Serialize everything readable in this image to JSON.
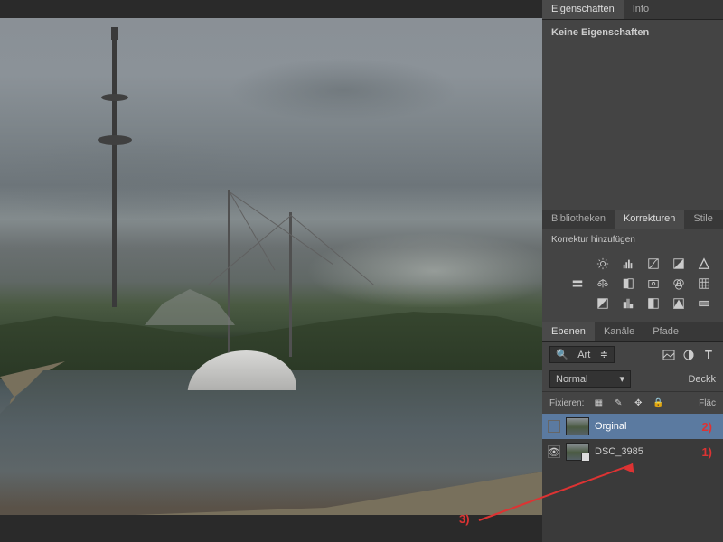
{
  "properties_panel": {
    "tabs": {
      "properties": "Eigenschaften",
      "info": "Info"
    },
    "empty_text": "Keine Eigenschaften"
  },
  "adjustments_panel": {
    "tabs": {
      "libraries": "Bibliotheken",
      "adjustments": "Korrekturen",
      "styles": "Stile"
    },
    "label": "Korrektur hinzufügen",
    "icons": [
      "brightness-icon",
      "levels-icon",
      "curves-icon",
      "exposure-icon",
      "vibrance-icon",
      "hue-icon",
      "balance-icon",
      "bw-icon",
      "photo-filter-icon",
      "channel-mixer-icon",
      "color-lookup-icon",
      "invert-icon",
      "posterize-icon",
      "threshold-icon",
      "selective-color-icon",
      "gradient-map-icon"
    ]
  },
  "layers_panel": {
    "tabs": {
      "layers": "Ebenen",
      "channels": "Kanäle",
      "paths": "Pfade"
    },
    "filter_label": "Art",
    "blend_mode": "Normal",
    "opacity_label": "Deckk",
    "lock_label": "Fixieren:",
    "fill_label": "Fläc",
    "filter_icons": [
      "filter-image-icon",
      "filter-adjust-icon",
      "filter-type-icon"
    ],
    "lock_icons": [
      "lock-pixels-icon",
      "lock-paint-icon",
      "lock-move-icon",
      "lock-all-icon"
    ],
    "layers": [
      {
        "name": "Orginal",
        "visible": false,
        "selected": true,
        "smart": false
      },
      {
        "name": "DSC_3985",
        "visible": true,
        "selected": false,
        "smart": true
      }
    ]
  },
  "annotations": {
    "a1": "1)",
    "a2": "2)",
    "a3": "3)"
  }
}
